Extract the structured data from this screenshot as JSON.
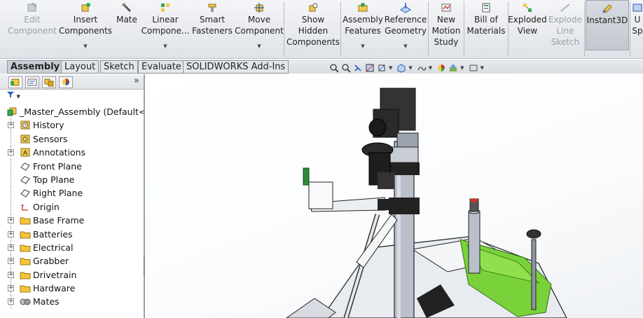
{
  "ribbon": {
    "buttons": [
      {
        "label": "Edit\nComponent",
        "icon": "edit-component-icon",
        "enabled": false
      },
      {
        "label": "Insert\nComponents",
        "icon": "insert-components-icon",
        "enabled": true
      },
      {
        "label": "Mate",
        "icon": "mate-icon",
        "enabled": true
      },
      {
        "label": "Linear\nCompone...",
        "icon": "linear-pattern-icon",
        "enabled": true
      },
      {
        "label": "Smart\nFasteners",
        "icon": "smart-fasteners-icon",
        "enabled": true
      },
      {
        "label": "Move\nComponent",
        "icon": "move-component-icon",
        "enabled": true
      },
      {
        "label": "Show\nHidden\nComponents",
        "icon": "show-hidden-icon",
        "enabled": true
      },
      {
        "label": "Assembly\nFeatures",
        "icon": "assembly-features-icon",
        "enabled": true
      },
      {
        "label": "Reference\nGeometry",
        "icon": "reference-geometry-icon",
        "enabled": true
      },
      {
        "label": "New\nMotion\nStudy",
        "icon": "motion-study-icon",
        "enabled": true
      },
      {
        "label": "Bill of\nMaterials",
        "icon": "bill-of-materials-icon",
        "enabled": true
      },
      {
        "label": "Exploded\nView",
        "icon": "exploded-view-icon",
        "enabled": true
      },
      {
        "label": "Explode\nLine\nSketch",
        "icon": "explode-line-sketch-icon",
        "enabled": false
      },
      {
        "label": "Instant3D",
        "icon": "instant3d-icon",
        "enabled": true
      },
      {
        "label": "U\nSp",
        "icon": "update-speedpak-icon",
        "enabled": true
      }
    ]
  },
  "command_tabs": [
    "Assembly",
    "Layout",
    "Sketch",
    "Evaluate",
    "SOLIDWORKS Add-Ins"
  ],
  "active_tab": "Assembly",
  "feature_tree": {
    "root": "_Master_Assembly  (Default<D",
    "items": [
      {
        "label": "History",
        "icon": "history-icon",
        "expandable": true
      },
      {
        "label": "Sensors",
        "icon": "sensors-icon",
        "expandable": false
      },
      {
        "label": "Annotations",
        "icon": "annotations-icon",
        "expandable": true
      },
      {
        "label": "Front Plane",
        "icon": "plane-icon",
        "expandable": false
      },
      {
        "label": "Top Plane",
        "icon": "plane-icon",
        "expandable": false
      },
      {
        "label": "Right Plane",
        "icon": "plane-icon",
        "expandable": false
      },
      {
        "label": "Origin",
        "icon": "origin-icon",
        "expandable": false
      },
      {
        "label": "Base Frame",
        "icon": "folder-icon",
        "expandable": true
      },
      {
        "label": "Batteries",
        "icon": "folder-icon",
        "expandable": true
      },
      {
        "label": "Electrical",
        "icon": "folder-icon",
        "expandable": true
      },
      {
        "label": "Grabber",
        "icon": "folder-icon",
        "expandable": true
      },
      {
        "label": "Drivetrain",
        "icon": "folder-icon",
        "expandable": true
      },
      {
        "label": "Hardware",
        "icon": "folder-icon",
        "expandable": true
      },
      {
        "label": "Mates",
        "icon": "mates-icon",
        "expandable": true
      }
    ]
  },
  "panel": {
    "collapse_glyph": "»",
    "filter_glyph": "▼"
  },
  "colors": {
    "accent_yellow": "#f2c94c",
    "component_green": "#7ad23a",
    "part_gray": "#b9c0cb"
  }
}
